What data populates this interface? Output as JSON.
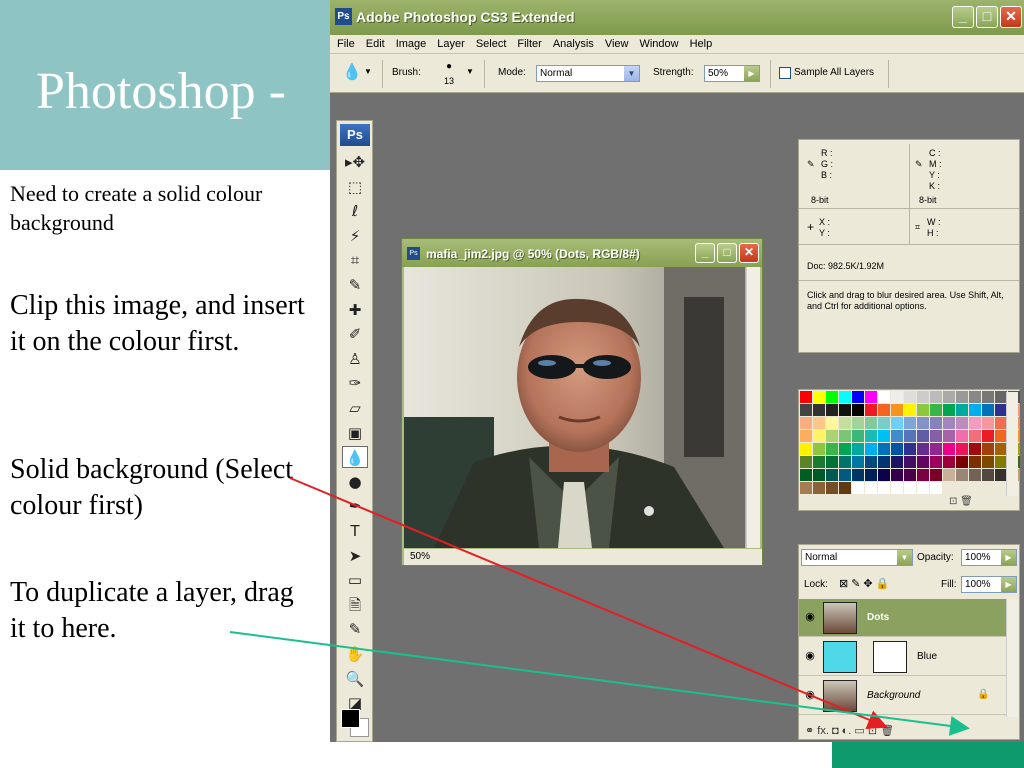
{
  "slide": {
    "title": "Photoshop -",
    "note1": "Need to create a solid colour background",
    "note2": "Clip this image, and insert it on the colour first.",
    "note3": "Solid background (Select colour first)",
    "note4": "To duplicate a layer, drag it to here."
  },
  "app": {
    "title": "Adobe Photoshop CS3 Extended",
    "logo": "Ps",
    "window_buttons": [
      "_",
      "□",
      "✕"
    ]
  },
  "menu": [
    "File",
    "Edit",
    "Image",
    "Layer",
    "Select",
    "Filter",
    "Analysis",
    "View",
    "Window",
    "Help"
  ],
  "options": {
    "brush_label": "Brush:",
    "brush_size": "13",
    "mode_label": "Mode:",
    "mode_value": "Normal",
    "strength_label": "Strength:",
    "strength_value": "50%",
    "sample_all_layers": "Sample All Layers"
  },
  "toolbox": {
    "logo": "Ps",
    "tools": [
      {
        "name": "move-tool-icon",
        "glyph": "▸✥"
      },
      {
        "name": "marquee-tool-icon",
        "glyph": "⬚"
      },
      {
        "name": "lasso-tool-icon",
        "glyph": "ℓ"
      },
      {
        "name": "magic-wand-tool-icon",
        "glyph": "⚡"
      },
      {
        "name": "crop-tool-icon",
        "glyph": "⌗"
      },
      {
        "name": "slice-tool-icon",
        "glyph": "✎"
      },
      {
        "name": "healing-brush-tool-icon",
        "glyph": "✚"
      },
      {
        "name": "brush-tool-icon",
        "glyph": "✐"
      },
      {
        "name": "clone-stamp-tool-icon",
        "glyph": "♙"
      },
      {
        "name": "history-brush-tool-icon",
        "glyph": "✑"
      },
      {
        "name": "eraser-tool-icon",
        "glyph": "▱"
      },
      {
        "name": "gradient-tool-icon",
        "glyph": "▣"
      },
      {
        "name": "blur-tool-icon",
        "glyph": "💧"
      },
      {
        "name": "dodge-tool-icon",
        "glyph": "●"
      },
      {
        "name": "pen-tool-icon",
        "glyph": "✒"
      },
      {
        "name": "type-tool-icon",
        "glyph": "T"
      },
      {
        "name": "path-selection-tool-icon",
        "glyph": "➤"
      },
      {
        "name": "shape-tool-icon",
        "glyph": "▭"
      },
      {
        "name": "notes-tool-icon",
        "glyph": "🗎"
      },
      {
        "name": "eyedropper-tool-icon",
        "glyph": "✎"
      },
      {
        "name": "hand-tool-icon",
        "glyph": "✋"
      },
      {
        "name": "zoom-tool-icon",
        "glyph": "🔍"
      },
      {
        "name": "default-colors-icon",
        "glyph": "◪ ⇆"
      }
    ],
    "active_tool_index": 12
  },
  "document": {
    "title": "mafia_jim2.jpg @ 50% (Dots, RGB/8#)",
    "zoom": "50%"
  },
  "info": {
    "r": "R :",
    "g": "G :",
    "b": "B :",
    "c": "C :",
    "m": "M :",
    "y": "Y :",
    "k": "K :",
    "bits_left": "8-bit",
    "bits_right": "8-bit",
    "x": "X :",
    "y2": "Y :",
    "w": "W :",
    "h": "H :",
    "doc": "Doc: 982.5K/1.92M",
    "hint": "Click and drag to blur desired area.  Use Shift, Alt, and Ctrl for additional options."
  },
  "swatches": {
    "colors": [
      "#ff0000",
      "#ffff00",
      "#00ff00",
      "#00ffff",
      "#0000ff",
      "#ff00ff",
      "#ffffff",
      "#eeeeee",
      "#dddddd",
      "#cccccc",
      "#bbbbbb",
      "#aaaaaa",
      "#999999",
      "#888888",
      "#777777",
      "#666666",
      "#555555",
      "#444444",
      "#333333",
      "#222222",
      "#111111",
      "#000000",
      "#ed1c24",
      "#f26522",
      "#f7941d",
      "#fff200",
      "#8dc63f",
      "#39b54a",
      "#00a651",
      "#00a99d",
      "#00aeef",
      "#0072bc",
      "#2e3192",
      "#f69679",
      "#f9ad81",
      "#fdc68a",
      "#fff799",
      "#c4df9b",
      "#a3d39c",
      "#82ca9c",
      "#7accc8",
      "#6dcff6",
      "#7da7d9",
      "#8393ca",
      "#8781bd",
      "#a186be",
      "#bd8cbf",
      "#f49ac1",
      "#f5989d",
      "#f26c4f",
      "#f68e55",
      "#fbaf5c",
      "#fff467",
      "#acd372",
      "#7cc576",
      "#3bb878",
      "#1abbb4",
      "#00bff3",
      "#438ccb",
      "#5574b9",
      "#605ca8",
      "#855fa8",
      "#a763a8",
      "#f06ea9",
      "#f26d7d",
      "#ed1c24",
      "#f26522",
      "#f7941d",
      "#fff200",
      "#8dc63f",
      "#39b54a",
      "#00a651",
      "#00a99d",
      "#00aeef",
      "#0072bc",
      "#0054a6",
      "#2e3192",
      "#662d91",
      "#92278f",
      "#ec008c",
      "#ed145b",
      "#9e0b0f",
      "#a0410d",
      "#a36209",
      "#aba000",
      "#598527",
      "#1a7b30",
      "#007236",
      "#00746b",
      "#0076a3",
      "#004a80",
      "#003471",
      "#1b1464",
      "#440e62",
      "#630460",
      "#9e005d",
      "#9e0039",
      "#790000",
      "#7b2e00",
      "#7d4900",
      "#827b00",
      "#406618",
      "#005e20",
      "#005826",
      "#005952",
      "#005b7f",
      "#003663",
      "#002157",
      "#0d004c",
      "#32004b",
      "#4b0049",
      "#7b0046",
      "#7a0026",
      "#c7b299",
      "#998675",
      "#736357",
      "#534741",
      "#37302d",
      "#c69c6d",
      "#a67c52",
      "#8c6239",
      "#754c24",
      "#603913",
      "#ffffff",
      "#ffffff",
      "#ffffff",
      "#ffffff",
      "#ffffff",
      "#ffffff",
      "#ffffff"
    ],
    "footer": "⊡  🗑"
  },
  "layers": {
    "blend_mode": "Normal",
    "opacity_label": "Opacity:",
    "opacity_value": "100%",
    "lock_label": "Lock:",
    "fill_label": "Fill:",
    "fill_value": "100%",
    "items": [
      {
        "name": "Dots",
        "selected": true
      },
      {
        "name": "Blue",
        "selected": false
      },
      {
        "name": "Background",
        "selected": false
      }
    ],
    "footer_icons": "⚭  fx.  ◘  ◐.  ▭  ⊡  🗑"
  },
  "colors": {
    "accent_teal": "#8fc4c4",
    "xp_green": "#8aa15f",
    "arrow_red": "#e31e24",
    "arrow_green": "#19c08e"
  }
}
